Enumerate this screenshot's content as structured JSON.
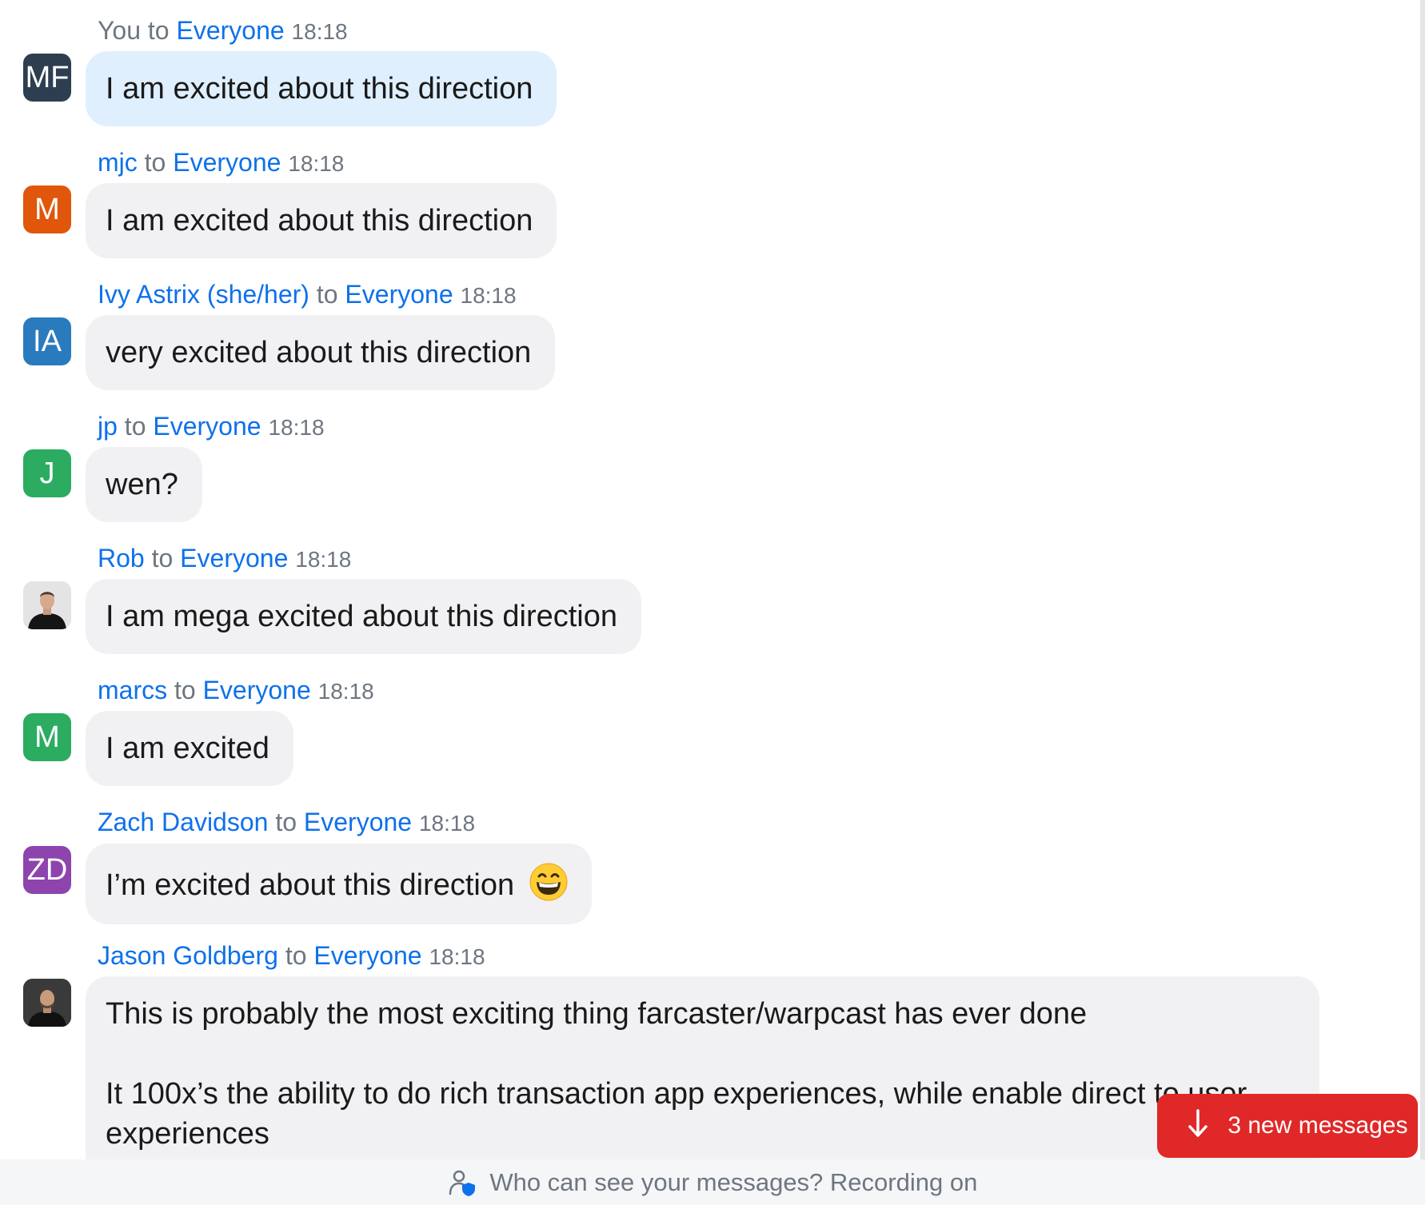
{
  "messages": [
    {
      "sender": "You",
      "connector": "to",
      "recipient": "Everyone",
      "time": "18:18",
      "initials": "MF",
      "avatar_color": "#2d3e50",
      "text": "I am excited about this direction"
    },
    {
      "sender": "mjc",
      "connector": "to",
      "recipient": "Everyone",
      "time": "18:18",
      "initials": "M",
      "avatar_color": "#e0560b",
      "text": "I am excited about this direction"
    },
    {
      "sender": "Ivy Astrix (she/her)",
      "connector": "to",
      "recipient": "Everyone",
      "time": "18:18",
      "initials": "IA",
      "avatar_color": "#2a7bbd",
      "text": "very excited about this direction"
    },
    {
      "sender": "jp",
      "connector": "to",
      "recipient": "Everyone",
      "time": "18:18",
      "initials": "J",
      "avatar_color": "#2bac60",
      "text": "wen?"
    },
    {
      "sender": "Rob",
      "connector": "to",
      "recipient": "Everyone",
      "time": "18:18",
      "avatar": "photo",
      "text": "I am mega excited about this direction"
    },
    {
      "sender": "marcs",
      "connector": "to",
      "recipient": "Everyone",
      "time": "18:18",
      "initials": "M",
      "avatar_color": "#2bac60",
      "text": "I am excited"
    },
    {
      "sender": "Zach Davidson",
      "connector": "to",
      "recipient": "Everyone",
      "time": "18:18",
      "initials": "ZD",
      "avatar_color": "#8e44ad",
      "text": "I’m excited about this direction",
      "emoji": "grinning-face-emoji"
    },
    {
      "sender": "Jason Goldberg",
      "connector": "to",
      "recipient": "Everyone",
      "time": "18:18",
      "avatar": "photo",
      "text_line1": "This is probably the most exciting thing farcaster/warpcast has ever done",
      "text_line2": "It 100x’s the ability to do rich transaction app experiences, while enable direct to user",
      "text_line3": "experiences"
    }
  ],
  "new_messages_button": {
    "label": "3 new messages",
    "icon": "arrow-down-icon",
    "color": "#e02828"
  },
  "footer": {
    "text": "Who can see your messages? Recording on",
    "icon": "user-shield-icon"
  },
  "colors": {
    "link": "#0e71eb",
    "meta": "#6e7680",
    "own_bubble": "#dfeffe",
    "bubble": "#f1f1f4"
  }
}
